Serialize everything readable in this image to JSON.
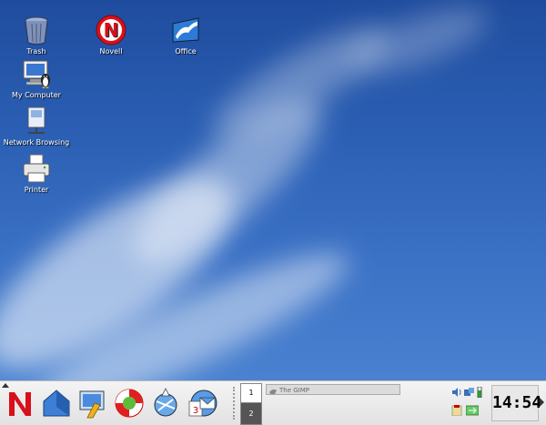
{
  "desktop": {
    "icons": [
      {
        "label": "Trash",
        "icon": "trash-icon"
      },
      {
        "label": "Novell",
        "icon": "novell-icon"
      },
      {
        "label": "Office",
        "icon": "office-icon"
      },
      {
        "label": "My Computer",
        "icon": "my-computer-icon"
      },
      {
        "label": "Network Browsing",
        "icon": "network-browsing-icon"
      },
      {
        "label": "Printer",
        "icon": "printer-icon"
      }
    ]
  },
  "taskbar": {
    "launchers": [
      "novell-menu-icon",
      "home-folder-icon",
      "control-center-icon",
      "help-icon",
      "network-icon",
      "mail-calendar-icon"
    ],
    "pager": {
      "desk1": "1",
      "desk2": "2"
    },
    "task_label": "The GIMP",
    "clock": "14:54"
  },
  "colors": {
    "novell_red": "#d8101a",
    "wallpaper_blue": "#2b5fb4"
  }
}
